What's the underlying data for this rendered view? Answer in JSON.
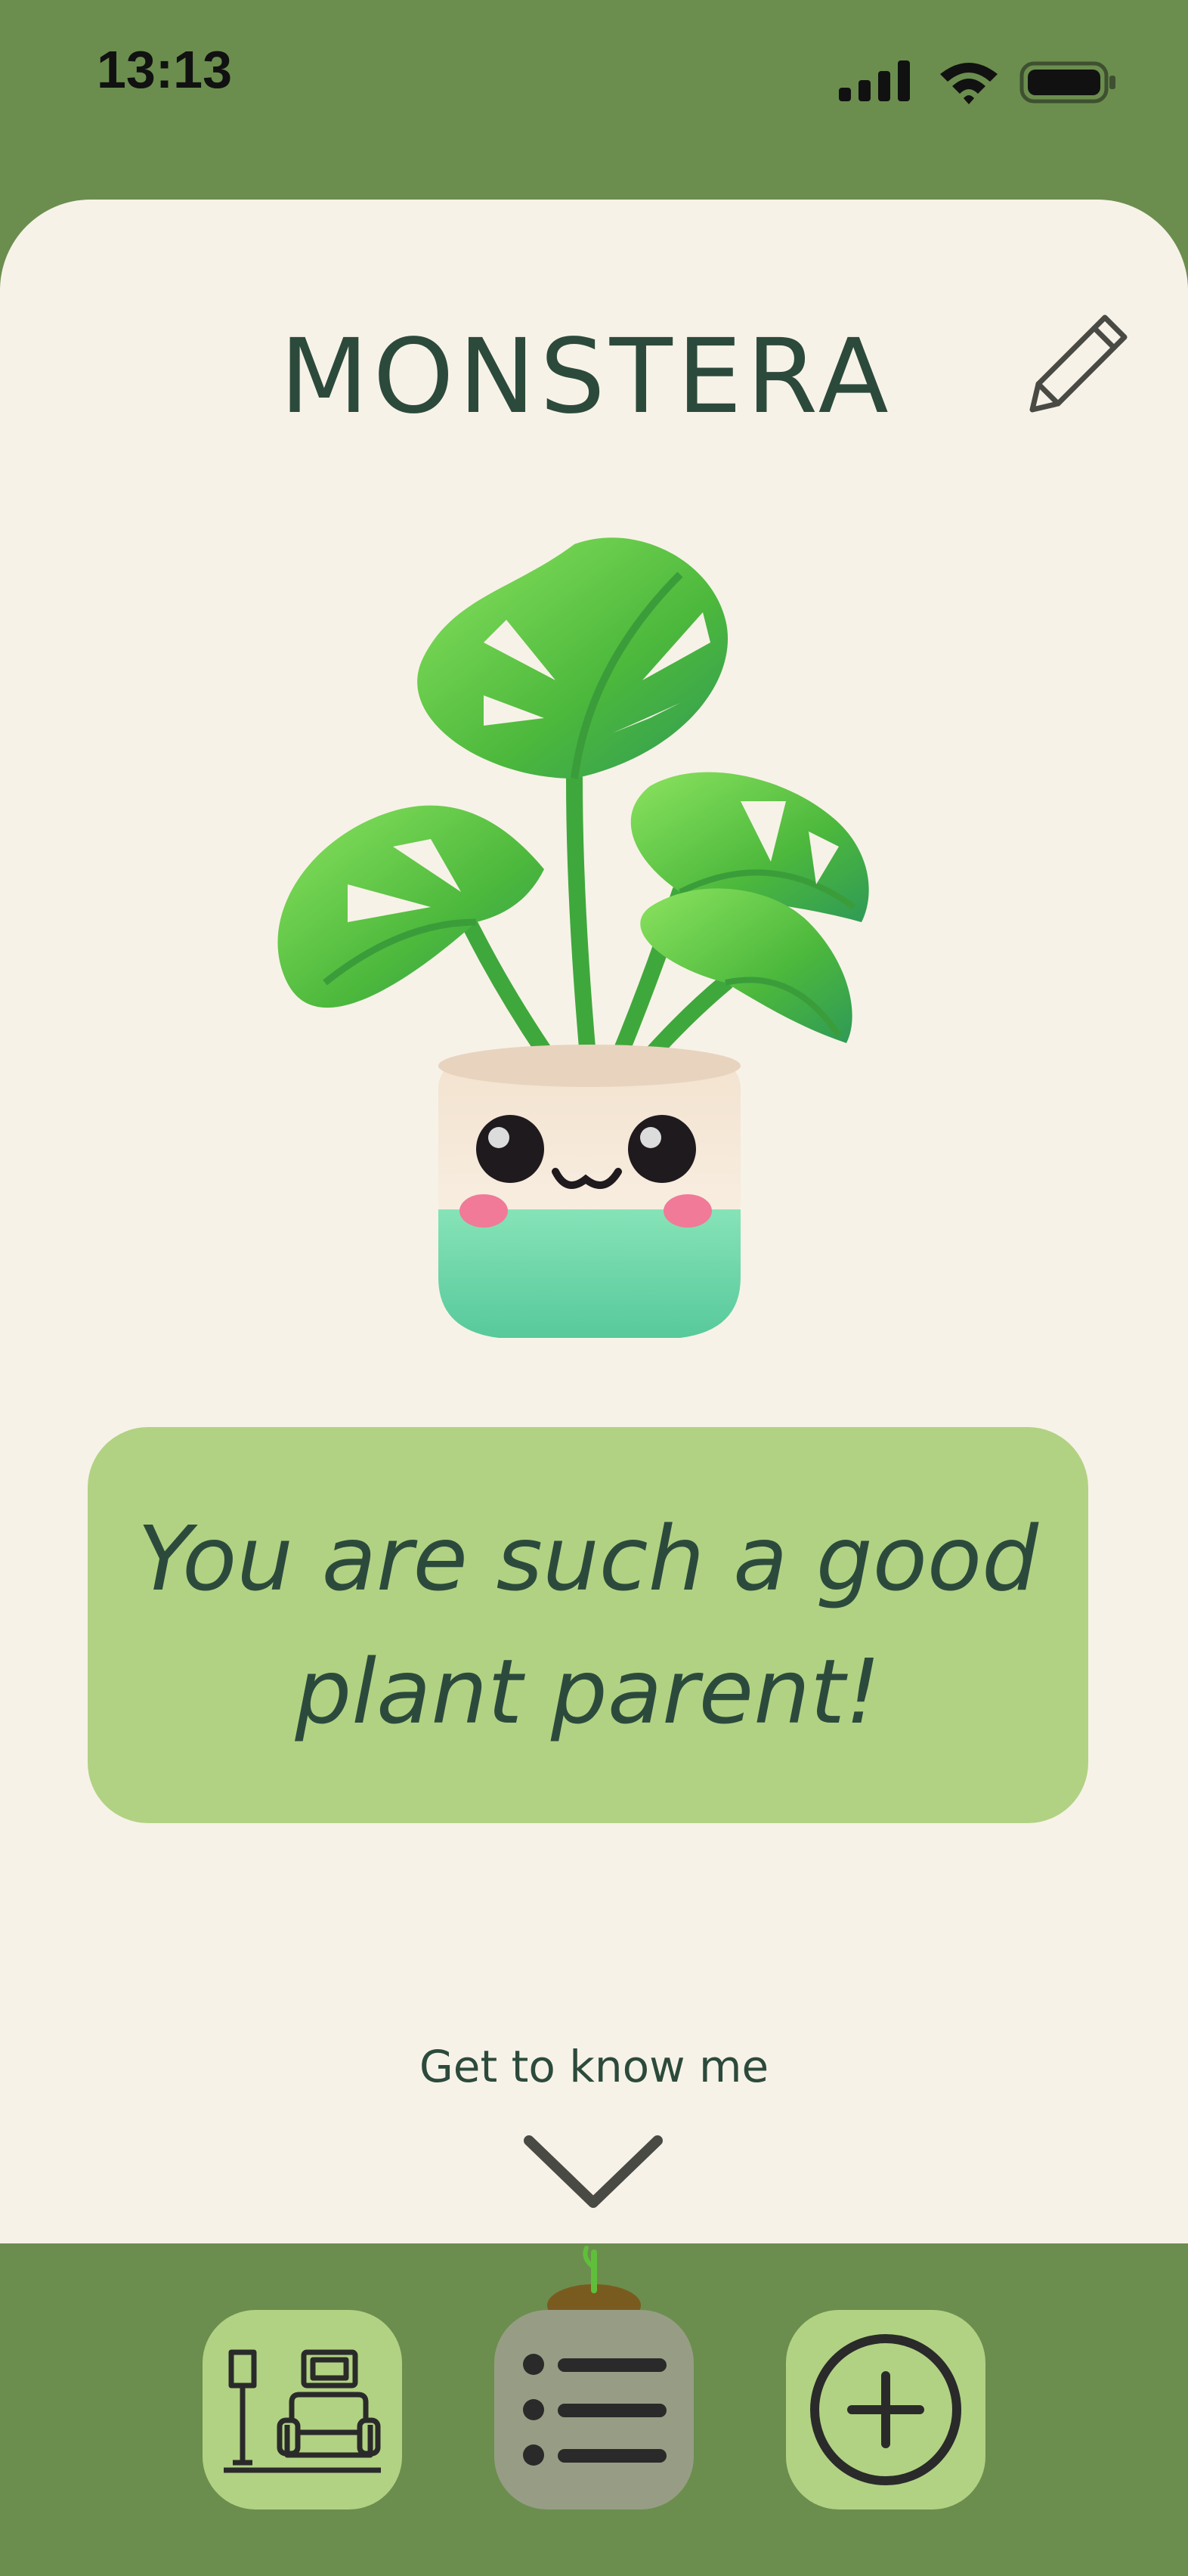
{
  "status_bar": {
    "time": "13:13",
    "icons": [
      "cellular-signal-icon",
      "wifi-icon",
      "battery-icon"
    ]
  },
  "header": {
    "title": "MONSTERA",
    "edit_icon": "pencil-icon"
  },
  "plant": {
    "image": "monstera-plant-illustration"
  },
  "message": {
    "text": "You are such a good plant parent!"
  },
  "get_to_know": {
    "label": "Get to know me",
    "icon": "chevron-down-icon"
  },
  "bottom_nav": {
    "items": [
      {
        "icon": "living-room-icon",
        "active": false
      },
      {
        "icon": "list-icon",
        "active": true
      },
      {
        "icon": "plus-circle-icon",
        "active": false
      }
    ]
  },
  "colors": {
    "background_green": "#6b8e4e",
    "card": "#f7f2e7",
    "accent_light_green": "#b1d283",
    "active_nav": "#979d84",
    "text_dark_green": "#2c4a3c"
  }
}
